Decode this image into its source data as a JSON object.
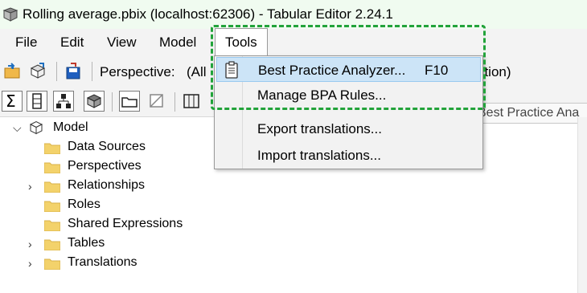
{
  "window": {
    "title": "Rolling average.pbix (localhost:62306) - Tabular Editor 2.24.1"
  },
  "menubar": {
    "items": [
      "File",
      "Edit",
      "View",
      "Model"
    ],
    "tools_label": "Tools"
  },
  "toolbar": {
    "perspective_label": "Perspective:",
    "perspective_value_left": "(All",
    "perspective_value_right": "ation)"
  },
  "tools_menu": {
    "items": [
      {
        "label": "Best Practice Analyzer...",
        "shortcut": "F10",
        "icon": "clipboard-icon"
      },
      {
        "label": "Manage BPA Rules...",
        "shortcut": ""
      },
      {
        "label": "Export translations...",
        "shortcut": ""
      },
      {
        "label": "Import translations...",
        "shortcut": ""
      }
    ]
  },
  "tooltip": {
    "text": "Best Practice Ana"
  },
  "tree": {
    "root": "Model",
    "children": [
      {
        "label": "Data Sources",
        "expandable": false
      },
      {
        "label": "Perspectives",
        "expandable": false
      },
      {
        "label": "Relationships",
        "expandable": true
      },
      {
        "label": "Roles",
        "expandable": false
      },
      {
        "label": "Shared Expressions",
        "expandable": false
      },
      {
        "label": "Tables",
        "expandable": true
      },
      {
        "label": "Translations",
        "expandable": true
      }
    ]
  },
  "colors": {
    "highlight": "#22a33a",
    "selection": "#cce4f7",
    "folder": "#f3d26b"
  }
}
